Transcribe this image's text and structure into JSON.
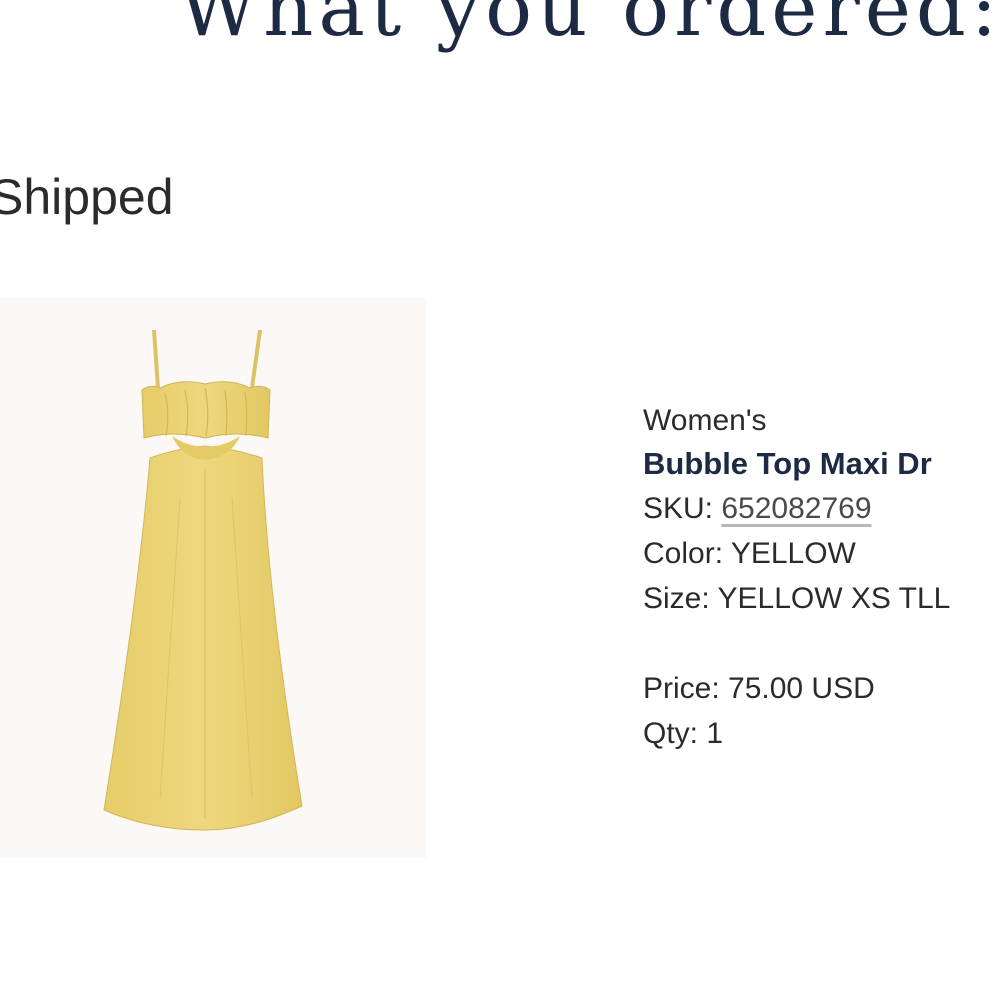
{
  "header": {
    "title": "What you ordered:"
  },
  "order": {
    "status": "Shipped"
  },
  "item": {
    "image_alt": "yellow-maxi-dress-photo",
    "category": "Women's",
    "name": "Bubble Top Maxi Dr",
    "sku_label": "SKU: ",
    "sku": "652082769",
    "color_line": "Color: YELLOW",
    "size_line": "Size: YELLOW XS TLL",
    "price_line": "Price: 75.00 USD",
    "qty_line": "Qty: 1",
    "dress_color": "#e8cf6a"
  }
}
